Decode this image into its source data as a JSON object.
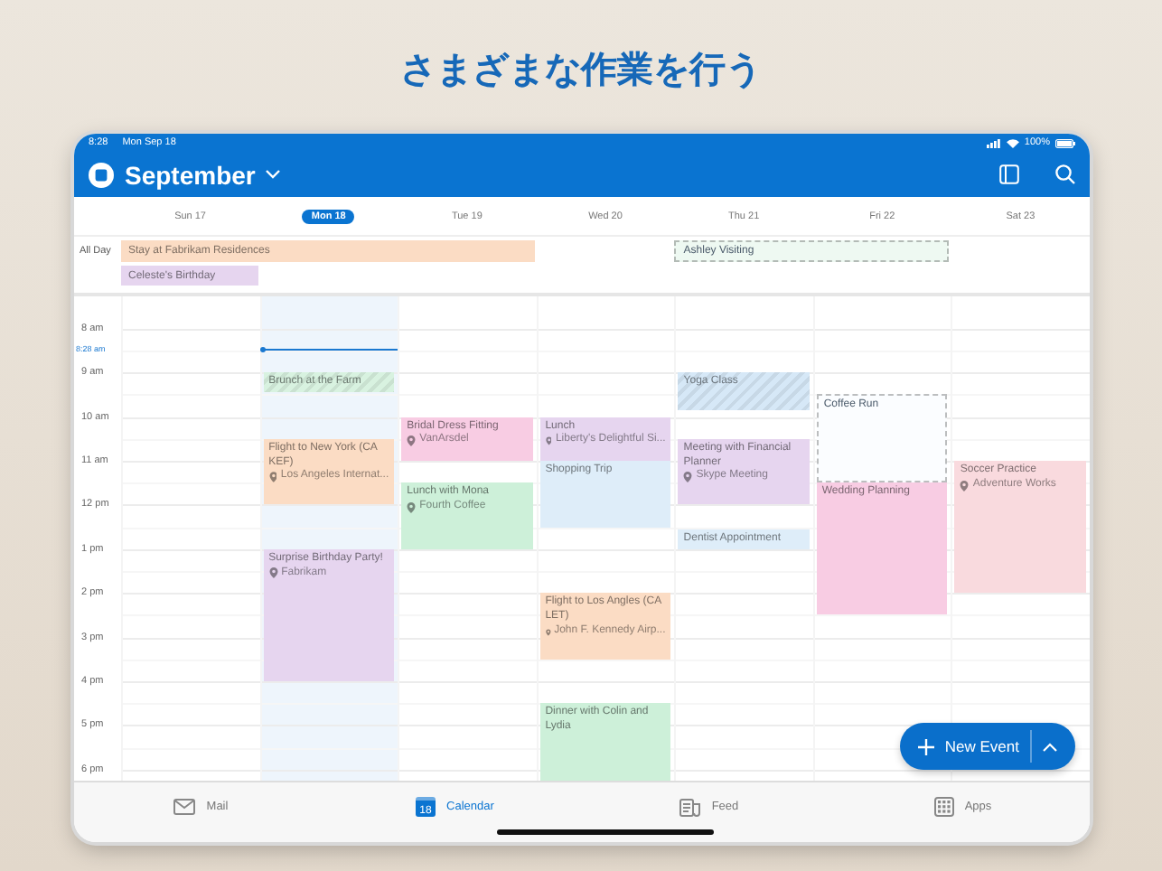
{
  "headline": "さまざまな作業を行う",
  "status_bar": {
    "time": "8:28",
    "date": "Mon Sep 18",
    "battery": "100%"
  },
  "header": {
    "title": "September"
  },
  "days": [
    {
      "label": "Sun 17",
      "selected": false
    },
    {
      "label": "Mon 18",
      "selected": true,
      "events": [
        {
          "title": "Brunch at the Farm",
          "color": "#d8f2e0",
          "kind": "striped"
        },
        {
          "title": "Flight to New York (CA KEF)",
          "location": "Los Angeles Internat...",
          "color": "#fbdcc4",
          "kind": "solid"
        },
        {
          "title": "Surprise Birthday Party!",
          "location": "Fabrikam",
          "color": "#e6d5ef",
          "kind": "solid"
        }
      ]
    },
    {
      "label": "Tue 19",
      "selected": false,
      "events": [
        {
          "title": "Bridal Dress Fitting",
          "location": "VanArsdel",
          "color": "#f8cce3",
          "kind": "solid"
        },
        {
          "title": "Lunch with Mona",
          "location": "Fourth Coffee",
          "color": "#cdf0d9",
          "kind": "solid"
        }
      ]
    },
    {
      "label": "Wed 20",
      "selected": false,
      "events": [
        {
          "title": "Lunch",
          "location": "Liberty's Delightful Si...",
          "color": "#e6d5ef",
          "kind": "solid"
        },
        {
          "title": "Shopping Trip",
          "color": "#deedf9",
          "kind": "solid"
        },
        {
          "title": "Flight to Los Angles (CA LET)",
          "location": "John F. Kennedy Airp...",
          "color": "#fbdcc4",
          "kind": "solid"
        },
        {
          "title": "Dinner with Colin and Lydia",
          "color": "#cdf0d9",
          "kind": "solid"
        }
      ]
    },
    {
      "label": "Thu 21",
      "selected": false,
      "events": [
        {
          "title": "Yoga Class",
          "color": "#d6e8f7",
          "kind": "striped"
        },
        {
          "title": "Meeting with Financial Planner",
          "location": "Skype Meeting",
          "color": "#e6d5ef",
          "kind": "solid"
        },
        {
          "title": "Dentist Appointment",
          "color": "#deedf9",
          "kind": "solid"
        }
      ]
    },
    {
      "label": "Fri 22",
      "selected": false,
      "events": [
        {
          "title": "Coffee Run",
          "color": "#fbfdff",
          "kind": "outline"
        },
        {
          "title": "Wedding Planning",
          "color": "#f8cce3",
          "kind": "solid"
        }
      ]
    },
    {
      "label": "Sat 23",
      "selected": false,
      "events": [
        {
          "title": "Soccer Practice",
          "location": "Adventure Works",
          "color": "#f9dade",
          "kind": "solid"
        }
      ]
    }
  ],
  "all_day": {
    "label": "All Day",
    "events": [
      {
        "title": "Stay at Fabrikam Residences",
        "color": "#fbdcc4",
        "kind": "solid"
      },
      {
        "title": "Celeste's Birthday",
        "color": "#e6d5ef",
        "kind": "solid"
      },
      {
        "title": "Ashley Visiting",
        "color": "#eef9f2",
        "kind": "outline"
      }
    ]
  },
  "hours": [
    "8 am",
    "9 am",
    "10 am",
    "11 am",
    "12 pm",
    "1 pm",
    "2 pm",
    "3 pm",
    "4 pm",
    "5 pm",
    "6 pm"
  ],
  "now": {
    "label": "8:28 am"
  },
  "new_event": {
    "label": "New Event"
  },
  "tabs": [
    {
      "label": "Mail",
      "selected": false
    },
    {
      "label": "Calendar",
      "selected": true,
      "badge": "18"
    },
    {
      "label": "Feed",
      "selected": false
    },
    {
      "label": "Apps",
      "selected": false
    }
  ]
}
